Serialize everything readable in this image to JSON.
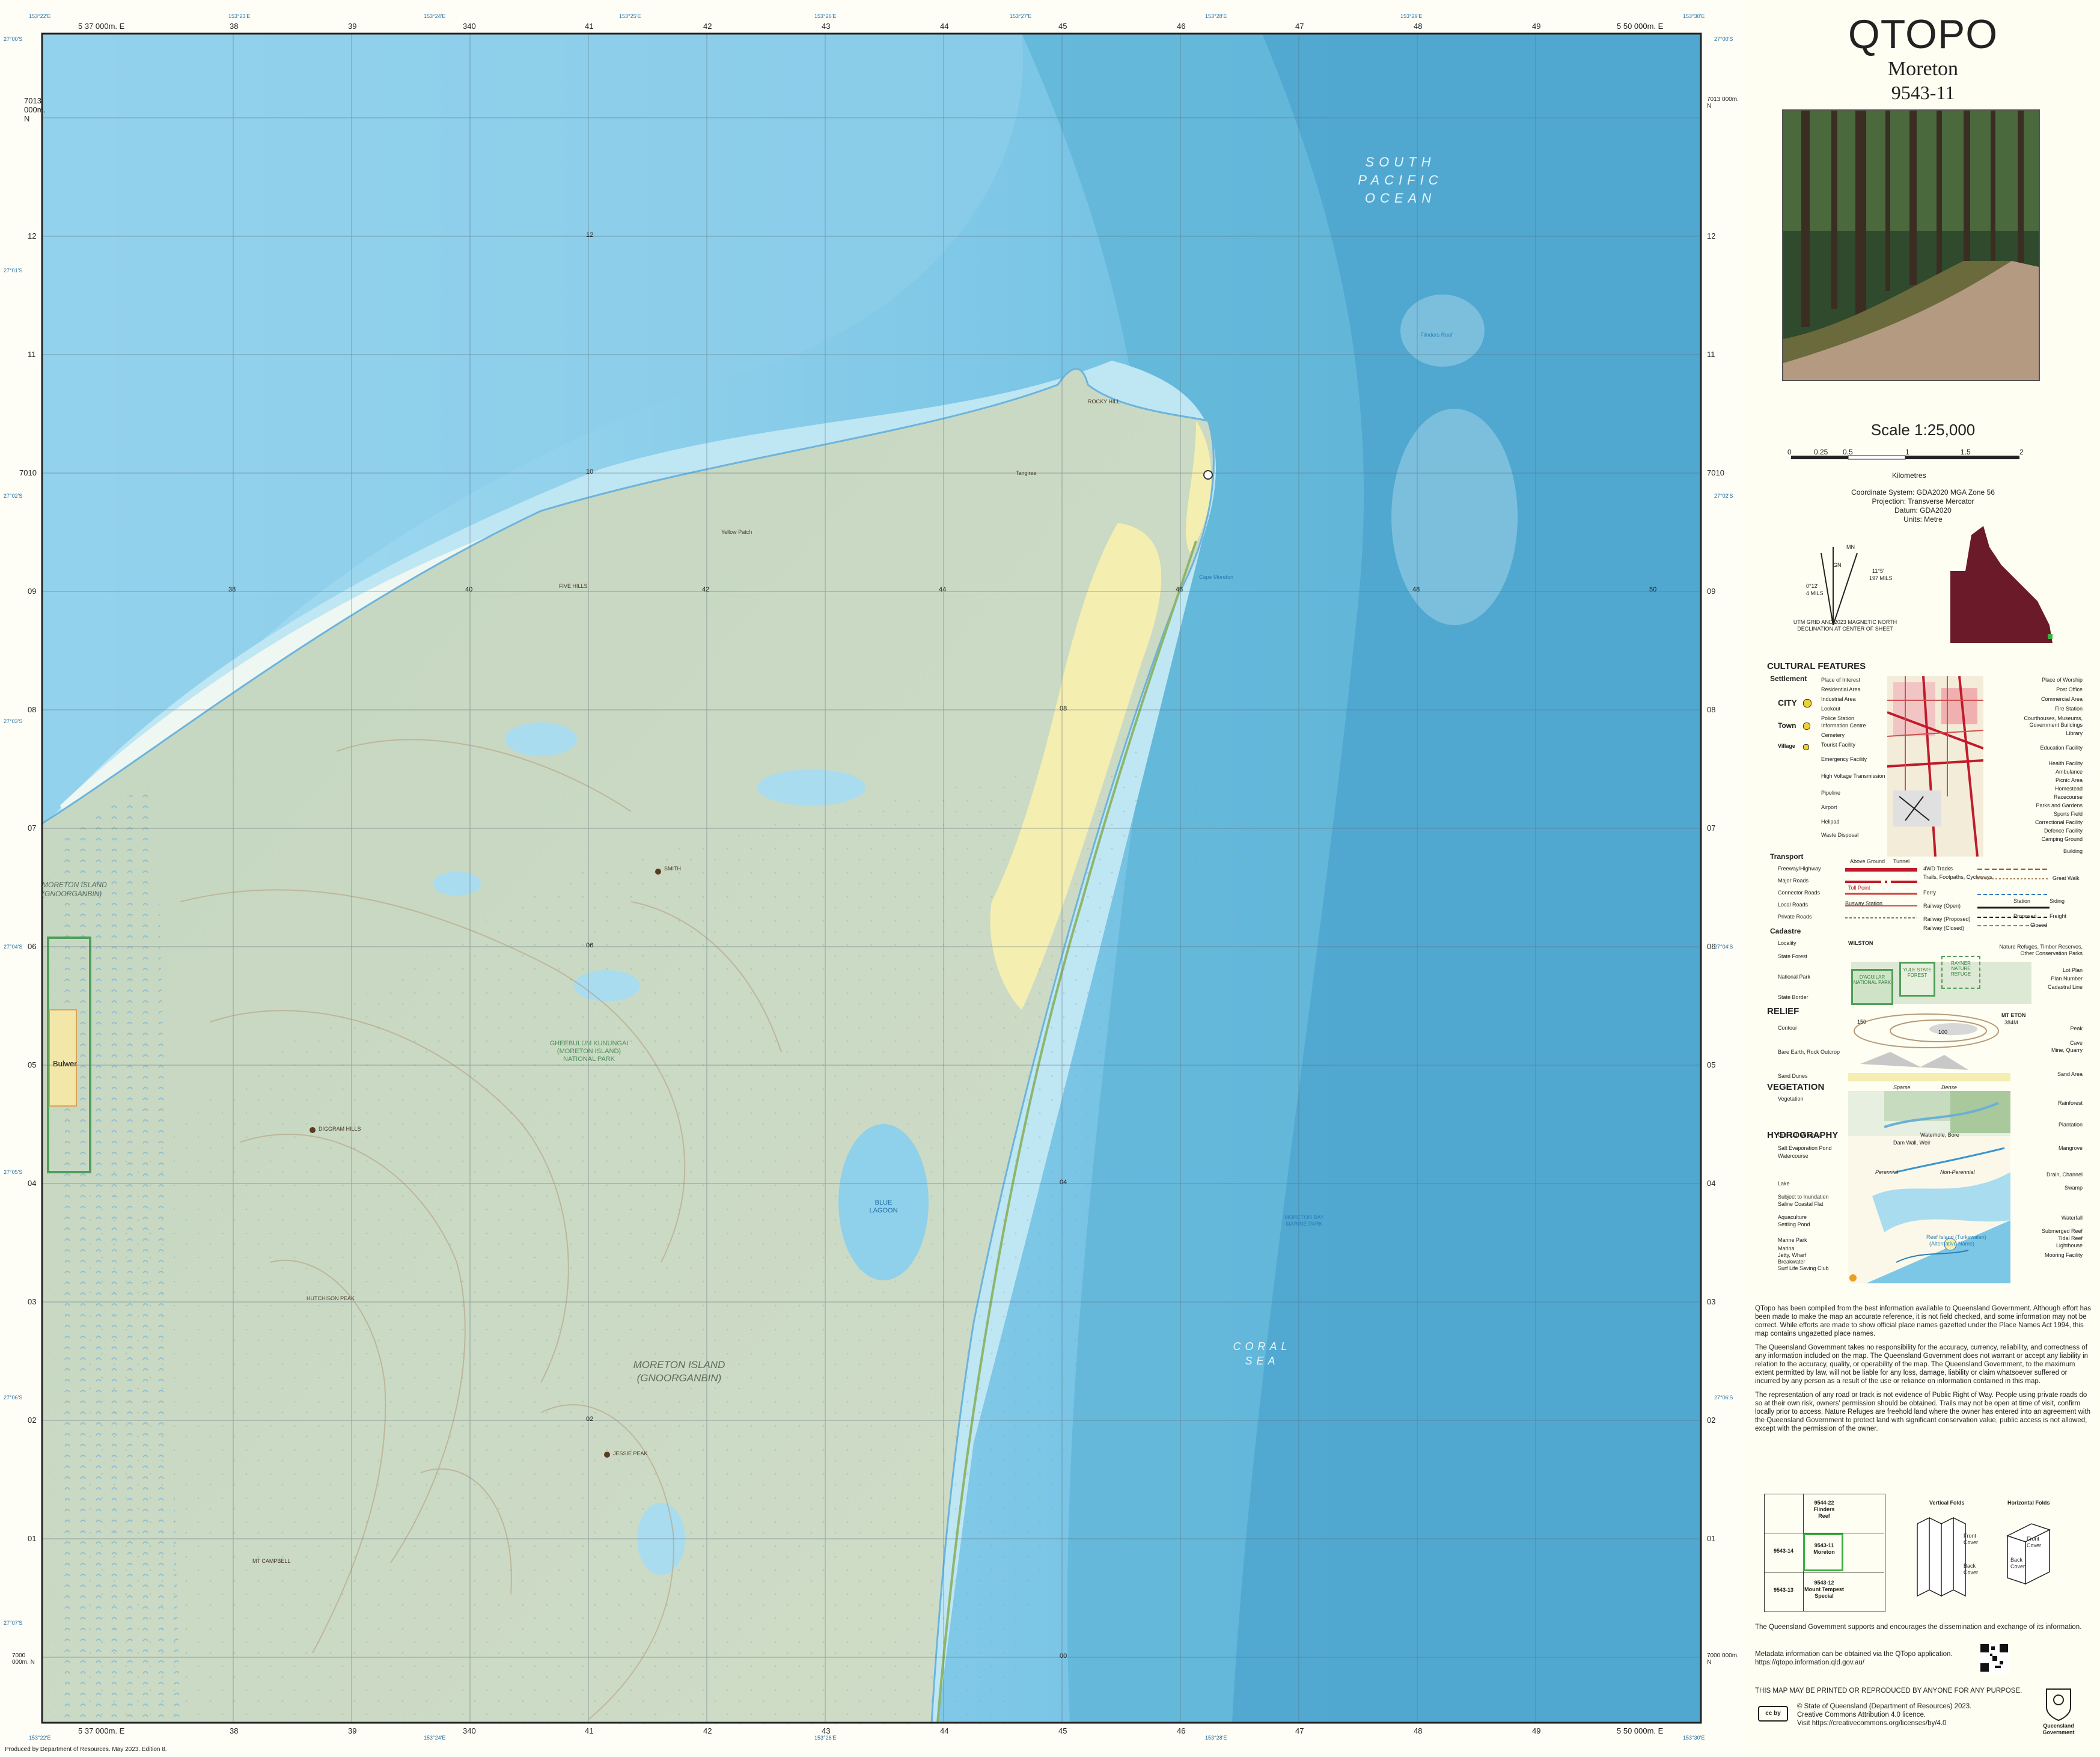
{
  "header": {
    "title": "QTOPO",
    "sheet_name": "Moreton",
    "sheet_number": "9543-11"
  },
  "scale": {
    "label": "Scale 1:25,000",
    "ticks": [
      "0",
      "0.25",
      "0.5",
      "1",
      "1.5",
      "2"
    ],
    "unit": "Kilometres"
  },
  "projection": [
    "Coordinate System: GDA2020 MGA Zone 56",
    "Projection: Transverse Mercator",
    "Datum: GDA2020",
    "Units: Metre"
  ],
  "declination": {
    "mn": "MN",
    "gn": "GN",
    "angle1": "0°12'",
    "mils1": "4 MILS",
    "angle2": "11°5'",
    "mils2": "197 MILS",
    "caption1": "UTM GRID AND 2023 MAGNETIC NORTH",
    "caption2": "DECLINATION AT CENTER OF SHEET"
  },
  "map_labels": {
    "ocean": [
      "SOUTH",
      "PACIFIC",
      "OCEAN"
    ],
    "coral": [
      "CORAL",
      "SEA"
    ],
    "island": [
      "MORETON ISLAND",
      "(GNOORGANBIN)"
    ],
    "island_w": [
      "MORETON ISLAND",
      "(GNOORGANBIN)"
    ],
    "park": [
      "GHEEBULUM KUNUNGAI",
      "(MORETON ISLAND)",
      "NATIONAL PARK"
    ],
    "blue_lagoon": [
      "BLUE",
      "LAGOON"
    ],
    "bulwer": "Bulwer",
    "smith": "SMITH",
    "diggram": "DIGGRAM HILLS",
    "mt_campbell": "MT CAMPBELL",
    "jessie": "JESSIE PEAK",
    "hutchison": "HUTCHISON PEAK",
    "five_hills": "FIVE HILLS",
    "rocky_hill": "ROCKY HILL",
    "tangalooma": "Tangiree",
    "yellow_patch": "Yellow Patch",
    "moreton_bay_park": [
      "MORETON BAY",
      "MARINE PARK"
    ],
    "flinders": "Flinders Reef",
    "cape": "Cape Moreton"
  },
  "grid": {
    "top_easting": [
      "5 37 000m. E",
      "38",
      "39",
      "340",
      "41",
      "42",
      "43",
      "44",
      "45",
      "46",
      "47",
      "48",
      "49",
      "5 50 000m. E"
    ],
    "northing": [
      "7013 000m. N",
      "12",
      "11",
      "7010",
      "09",
      "08",
      "07",
      "06",
      "05",
      "04",
      "03",
      "02",
      "01",
      "7000 000m. N"
    ],
    "inner_easting": [
      "38",
      "40",
      "42",
      "44",
      "46",
      "48",
      "50"
    ],
    "inner_northing": [
      "12",
      "10",
      "08",
      "06",
      "04",
      "02",
      "00"
    ],
    "lon": [
      "153°22'E",
      "153°23'E",
      "153°24'E",
      "153°25'E",
      "153°26'E",
      "153°27'E",
      "153°28'E",
      "153°29'E",
      "153°30'E"
    ],
    "lat": [
      "27°00'S",
      "27°01'S",
      "27°02'S",
      "27°03'S",
      "27°04'S",
      "27°05'S",
      "27°06'S",
      "27°07'S",
      "27°08'S",
      "27°09'S"
    ]
  },
  "legend": {
    "cultural": "CULTURAL FEATURES",
    "settlement": "Settlement",
    "city": "CITY",
    "town": "Town",
    "village": "Village",
    "left_items": [
      "Place of Interest",
      "Residential Area",
      "Industrial Area",
      "Lookout",
      "Police Station",
      "Information Centre",
      "Cemetery",
      "Tourist Facility",
      "Emergency Facility",
      "High Voltage Transmission",
      "Pipeline",
      "Airport",
      "Helipad",
      "Waste Disposal"
    ],
    "right_items": [
      "Place of Worship",
      "Post Office",
      "Commercial Area",
      "Fire Station",
      "Courthouses, Museums,",
      "Government Buildings",
      "Library",
      "Education Facility",
      "Health Facility",
      "Ambulance",
      "Picnic Area",
      "Homestead",
      "Racecourse",
      "Parks and Gardens",
      "Sports Field",
      "Correctional Facility",
      "Defence Facility",
      "Camping Ground",
      "Building"
    ],
    "transport": "Transport",
    "transport_items": [
      "Freeway/Highway",
      "Major Roads",
      "Connector Roads",
      "Local Roads",
      "Private Roads"
    ],
    "transport_right": [
      "4WD Tracks",
      "Trails, Footpaths, Cycleways",
      "Ferry",
      "Railway (Open)",
      "Railway (Proposed)",
      "Railway (Closed)"
    ],
    "transport_tags": [
      "Above Ground",
      "Tunnel",
      "Great Walk",
      "Toll Point",
      "Busway Station",
      "Station",
      "Siding",
      "Proposed",
      "Freight",
      "Closed"
    ],
    "cadastre": "Cadastre",
    "cadastre_items": [
      "Locality",
      "State Forest",
      "National Park",
      "State Border"
    ],
    "cadastre_right": [
      "Nature Refuges, Timber Reserves,",
      "Other Conservation Parks",
      "Lot Plan",
      "Plan Number",
      "Cadastral Line"
    ],
    "cad_example": [
      "WILSTON",
      "D'AGUILAR NATIONAL PARK",
      "YULE STATE FOREST",
      "RAYNER NATURE REFUGE"
    ],
    "relief": "RELIEF",
    "relief_items": [
      "Contour",
      "Bare Earth, Rock Outcrop",
      "Sand Dunes"
    ],
    "relief_right": [
      "Peak",
      "Cave",
      "Mine, Quarry",
      "Sand Area"
    ],
    "relief_example": [
      "MT ETON",
      "384M",
      "150",
      "100"
    ],
    "vegetation": "VEGETATION",
    "veg_items": [
      "Vegetation",
      "Orchard, Vineyard"
    ],
    "veg_right": [
      "Rainforest",
      "Plantation"
    ],
    "veg_tags": [
      "Sparse",
      "Dense"
    ],
    "hydrography": "HYDROGRAPHY",
    "hydro_items": [
      "Salt Evaporation Pond",
      "Watercourse",
      "Lake",
      "Subject to Inundation",
      "Saline Coastal Flat",
      "Aquaculture",
      "Settling Pond",
      "Marine Park",
      "Marina",
      "Jetty, Wharf",
      "Breakwater",
      "Surf Life Saving Club"
    ],
    "hydro_right": [
      "Mangrove",
      "Drain, Channel",
      "Swamp",
      "Waterfall",
      "Submerged Reef",
      "Tidal Reef",
      "Lighthouse",
      "Mooring Facility"
    ],
    "hydro_tags": [
      "Waterhole, Bore",
      "Dam Wall, Weir",
      "Perennial",
      "Non-Perennial",
      "Reef Island (Turkswalen)",
      "(Alternative Name)"
    ]
  },
  "disclaimer": [
    "QTopo has been compiled from the best information available to Queensland Government. Although effort has been made to make the map an accurate reference, it is not field checked, and some information may not be correct.  While efforts are made to show official place names gazetted under the Place Names Act 1994, this map contains ungazetted place names.",
    "The Queensland Government takes no responsibility for the accuracy, currency, reliability, and correctness of any information included on the map. The Queensland Government does not warrant or accept any liability in relation to the accuracy, quality, or operability of the map.  The Queensland Government, to the maximum extent permitted by law, will not be liable for any loss, damage, liability or claim whatsoever suffered or incurred by any person as a result of the use or reliance on information contained in this map.",
    "The representation of any road or track is not evidence of Public Right of Way.  People using private roads do so at their own risk, owners' permission should be obtained.  Trails may not be open at time of visit, confirm locally prior to access.  Nature Refuges are freehold land where the owner has entered into an agreement with the Queensland Government to protect land with significant conservation value, public access is not allowed, except with the permission of the owner."
  ],
  "index": {
    "cells": [
      [
        "",
        "9544-22",
        "Flinders",
        "Reef"
      ],
      [
        "9543-14",
        "9543-11",
        "Moreton",
        ""
      ],
      [
        "9543-13",
        "9543-12",
        "Mount Tempest",
        "Special"
      ]
    ],
    "vertical": "Vertical Folds",
    "horizontal": "Horizontal Folds",
    "fold_labels": [
      "Front Cover",
      "Back Cover",
      "Front Cover",
      "Back Cover"
    ]
  },
  "footer": {
    "support": "The Queensland Government supports and encourages the dissemination and exchange of its information.",
    "metadata": [
      "Metadata information can be obtained via the QTopo application.",
      "https://qtopo.information.qld.gov.au/"
    ],
    "printed": "THIS MAP MAY BE PRINTED OR REPRODUCED BY ANYONE FOR ANY PURPOSE.",
    "copyright": [
      "©  State of Queensland (Department of Resources) 2023.",
      "Creative Commons Attribution 4.0 licence.",
      "Visit https://creativecommons.org/licenses/by/4.0"
    ],
    "produced": "Produced by Department of Resources. May 2023. Edition 8.",
    "cc": "cc by",
    "crest": [
      "Queensland",
      "Government"
    ]
  },
  "colors": {
    "ocean_deep": "#5cb4d6",
    "ocean_shallow": "#8fd0ea",
    "land": "#c9d9c4",
    "sand": "#f4efb0",
    "border": "#2a6fb0",
    "state": "#6b1a2a"
  }
}
